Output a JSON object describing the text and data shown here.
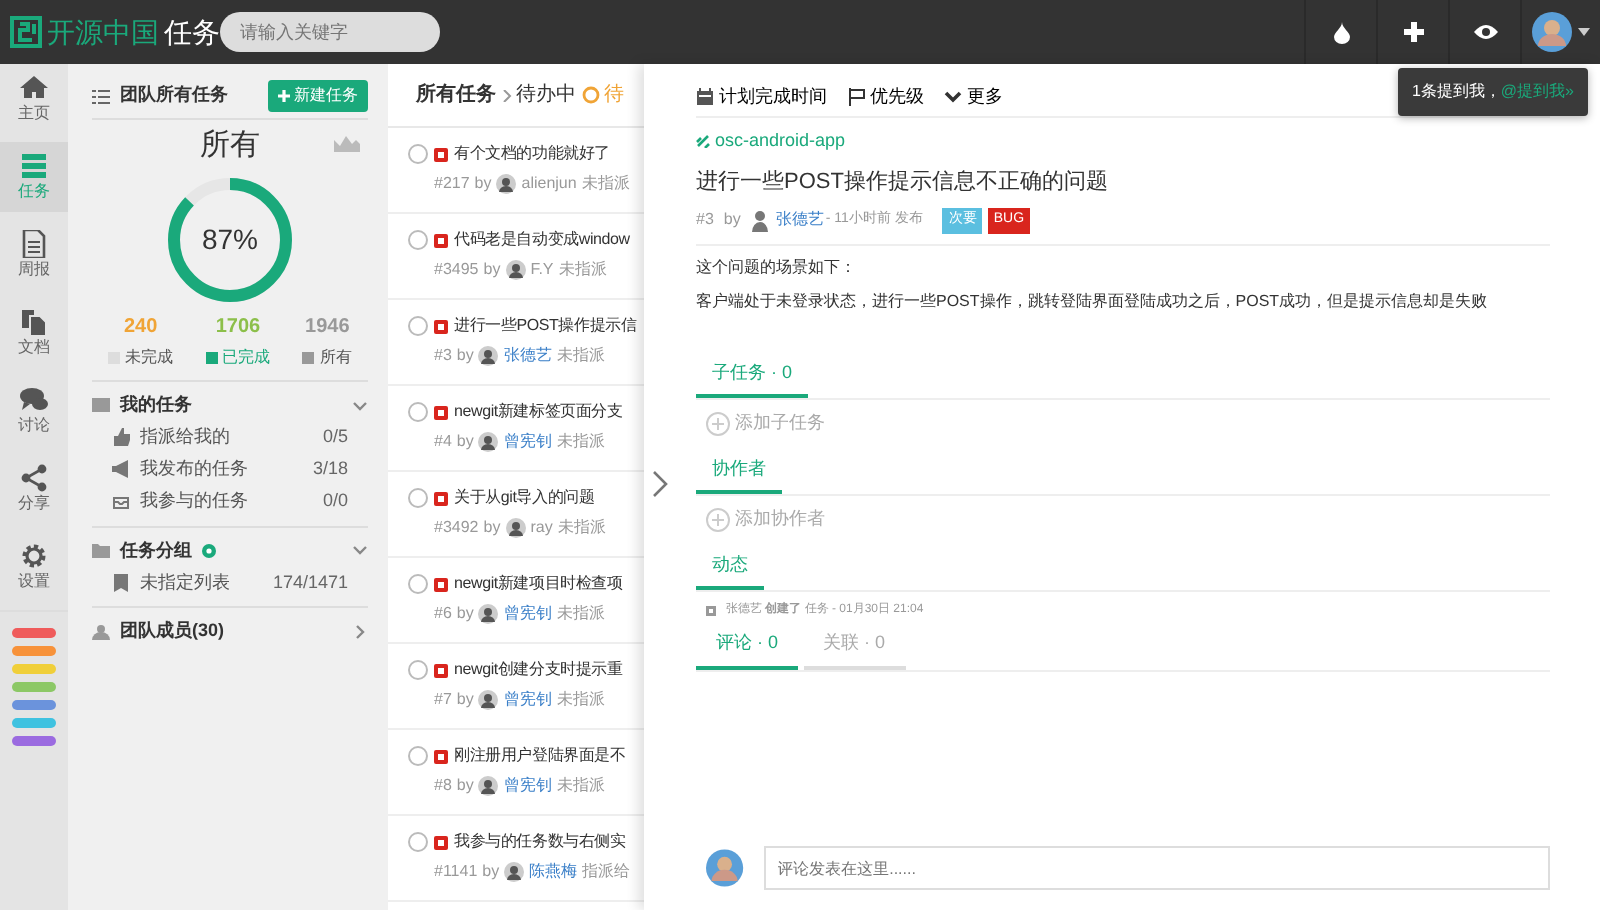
{
  "topbar": {
    "logo_text": "开源中国",
    "app_name": "任务",
    "search": {
      "placeholder": "请输入关键字"
    },
    "notice": {
      "text": "1条提到我，",
      "link": "@提到我»"
    }
  },
  "rail": {
    "items": [
      {
        "label": "主页",
        "selected": false
      },
      {
        "label": "任务",
        "selected": true
      },
      {
        "label": "周报",
        "selected": false
      },
      {
        "label": "文档",
        "selected": false
      },
      {
        "label": "讨论",
        "selected": false
      },
      {
        "label": "分享",
        "selected": false
      },
      {
        "label": "设置",
        "selected": false
      }
    ],
    "color_tags": [
      {
        "color": "#ef5b5b"
      },
      {
        "color": "#f7923a"
      },
      {
        "color": "#f0cf3a"
      },
      {
        "color": "#8cc866"
      },
      {
        "color": "#6b93dc"
      },
      {
        "color": "#3fc2e0"
      },
      {
        "color": "#9b6be0"
      }
    ]
  },
  "summary": {
    "title": "团队所有任务",
    "new_button": "新建任务",
    "scope": "所有",
    "percent": "87%",
    "level": 0.87,
    "stats": [
      {
        "value": {
          "text": "240",
          "color": "#f0a436"
        },
        "legend": {
          "label": "未完成",
          "color": "#dddddd"
        }
      },
      {
        "value": {
          "text": "1706",
          "color": "#8cbf4a"
        },
        "legend": {
          "label": "已完成",
          "color": "#1aa97b"
        }
      },
      {
        "value": {
          "text": "1946",
          "color": "#999999"
        },
        "legend": {
          "label": "所有",
          "color": "#999999"
        }
      }
    ],
    "sections": [
      {
        "title": "我的任务",
        "expanded": true,
        "items": [
          {
            "label": "指派给我的",
            "count": "0/5"
          },
          {
            "label": "我发布的任务",
            "count": "3/18"
          },
          {
            "label": "我参与的任务",
            "count": "0/0"
          }
        ]
      },
      {
        "title": "任务分组",
        "expanded": true,
        "items": [
          {
            "label": "未指定列表",
            "count": "174/1471"
          }
        ]
      },
      {
        "title": "团队成员(30)",
        "expanded": false
      }
    ]
  },
  "list": {
    "breadcrumb": [
      "所有任务",
      "待办中"
    ],
    "filter": "待",
    "tasks": [
      {
        "checked": false,
        "title": "有个文档的功能就好了",
        "number": "#217",
        "by": "by",
        "author": "alienjun",
        "linked": false,
        "assignee": "未指派"
      },
      {
        "checked": false,
        "title": "代码老是自动变成window",
        "number": "#3495",
        "by": "by",
        "author": "F.Y",
        "linked": false,
        "assignee": "未指派"
      },
      {
        "checked": false,
        "title": "进行一些POST操作提示信",
        "number": "#3",
        "by": "by",
        "author": "张德艺",
        "linked": true,
        "assignee": "未指派"
      },
      {
        "checked": false,
        "title": "newgit新建标签页面分支",
        "number": "#4",
        "by": "by",
        "author": "曾宪钊",
        "linked": true,
        "assignee": "未指派"
      },
      {
        "checked": false,
        "title": "关于从git导入的问题",
        "number": "#3492",
        "by": "by",
        "author": "ray",
        "linked": false,
        "assignee": "未指派"
      },
      {
        "checked": false,
        "title": "newgit新建项目时检查项",
        "number": "#6",
        "by": "by",
        "author": "曾宪钊",
        "linked": true,
        "assignee": "未指派"
      },
      {
        "checked": false,
        "title": "newgit创建分支时提示重",
        "number": "#7",
        "by": "by",
        "author": "曾宪钊",
        "linked": true,
        "assignee": "未指派"
      },
      {
        "checked": false,
        "title": "刚注册用户登陆界面是不",
        "number": "#8",
        "by": "by",
        "author": "曾宪钊",
        "linked": true,
        "assignee": "未指派"
      },
      {
        "checked": false,
        "title": "我参与的任务数与右侧实",
        "number": "#1141",
        "by": "by",
        "author": "陈燕梅",
        "linked": true,
        "assignee": "指派给"
      }
    ]
  },
  "detail": {
    "toolbar": [
      "计划完成时间",
      "优先级",
      "更多"
    ],
    "project": "osc-android-app",
    "title": "进行一些POST操作提示信息不正确的问题",
    "number": "#3",
    "by": "by",
    "author": "张德艺",
    "time": "- 11小时前 发布",
    "tags": [
      {
        "text": "次要",
        "color": "#5bbfe0"
      },
      {
        "text": "BUG",
        "color": "#d9251d"
      }
    ],
    "description": [
      "这个问题的场景如下：",
      "客户端处于未登录状态，进行一些POST操作，跳转登陆界面登陆成功之后，POST成功，但是提示信息却是失败"
    ],
    "sections": [
      {
        "tab": "子任务 · 0",
        "kind": "add",
        "action": "添加子任务"
      },
      {
        "tab": "协作者",
        "kind": "add",
        "action": "添加协作者"
      },
      {
        "tab": "动态",
        "kind": "activity",
        "text": "张德艺 **创建了** 任务 - 01月30日 21:04"
      }
    ],
    "comment_tabs": [
      {
        "label": "评论 · 0",
        "selected": true
      },
      {
        "label": "关联 · 0",
        "selected": false
      }
    ],
    "comment": {
      "placeholder": "评论发表在这里......"
    }
  }
}
